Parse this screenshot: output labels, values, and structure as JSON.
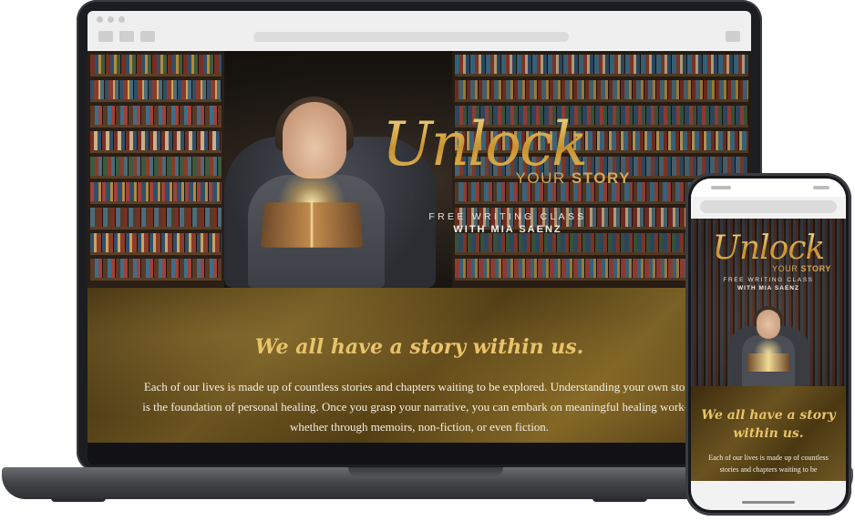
{
  "desktop": {
    "hero": {
      "title_word": "Unlock",
      "title_sub_light": "YOUR ",
      "title_sub_bold": "STORY",
      "class_line": "FREE WRITING CLASS",
      "instructor_line": "WITH MIA SAENZ"
    },
    "intro": {
      "heading": "We all have a story within us.",
      "body": "Each of our lives is made up of countless stories and chapters waiting to be explored. Understanding your own story is the foundation of personal healing. Once you grasp your narrative, you can embark on meaningful healing work—whether through memoirs, non-fiction, or even fiction."
    }
  },
  "mobile": {
    "hero": {
      "title_word": "Unlock",
      "title_sub_light": "YOUR ",
      "title_sub_bold": "STORY",
      "class_line": "FREE WRITING CLASS",
      "instructor_line": "WITH MIA SAENZ"
    },
    "intro": {
      "heading": "We all have a story within us.",
      "body": "Each of our lives is made up of countless stories and chapters waiting to be"
    }
  },
  "colors": {
    "gold_accent": "#d9ad4c",
    "laptop_frame": "#1c1d20",
    "gold_background": "#6b5420"
  }
}
